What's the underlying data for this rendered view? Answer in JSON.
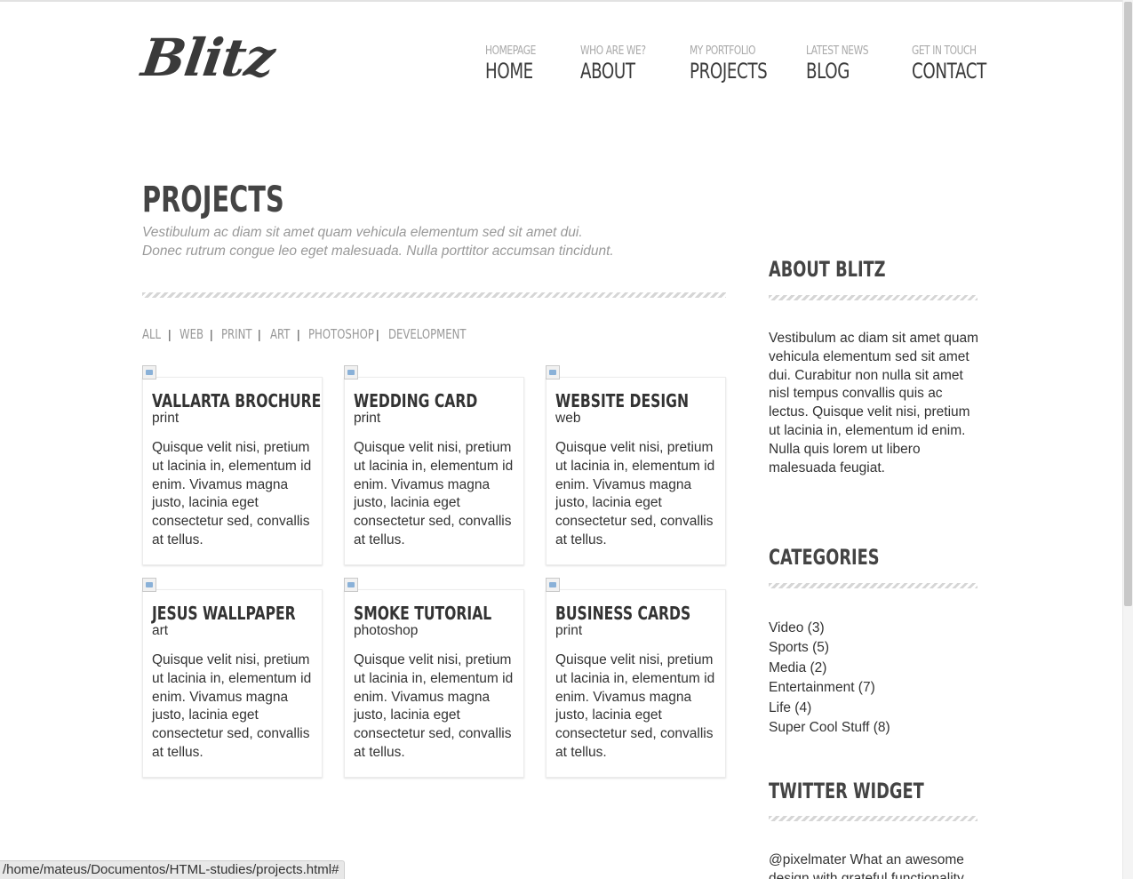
{
  "logo": "Blitz",
  "nav": [
    {
      "sub": "HOMEPAGE",
      "main": "HOME"
    },
    {
      "sub": "WHO ARE WE?",
      "main": "ABOUT"
    },
    {
      "sub": "MY PORTFOLIO",
      "main": "PROJECTS"
    },
    {
      "sub": "LATEST NEWS",
      "main": "BLOG"
    },
    {
      "sub": "GET IN TOUCH",
      "main": "CONTACT"
    }
  ],
  "page": {
    "title": "PROJECTS",
    "intro": "Vestibulum ac diam sit amet quam vehicula elementum sed sit amet dui. Donec rutrum congue leo eget malesuada. Nulla porttitor accumsan tincidunt."
  },
  "filters": [
    "ALL",
    "WEB",
    "PRINT",
    "ART",
    "PHOTOSHOP",
    "DEVELOPMENT"
  ],
  "filter_separator": "|",
  "projects": [
    {
      "title": "VALLARTA BROCHURE",
      "category": "print",
      "text": "Quisque velit nisi, pretium ut lacinia in, elementum id enim. Vivamus magna justo, lacinia eget consectetur sed, convallis at tellus."
    },
    {
      "title": "WEDDING CARD",
      "category": "print",
      "text": "Quisque velit nisi, pretium ut lacinia in, elementum id enim. Vivamus magna justo, lacinia eget consectetur sed, convallis at tellus."
    },
    {
      "title": "WEBSITE DESIGN",
      "category": "web",
      "text": "Quisque velit nisi, pretium ut lacinia in, elementum id enim. Vivamus magna justo, lacinia eget consectetur sed, convallis at tellus."
    },
    {
      "title": "JESUS WALLPAPER",
      "category": "art",
      "text": "Quisque velit nisi, pretium ut lacinia in, elementum id enim. Vivamus magna justo, lacinia eget consectetur sed, convallis at tellus."
    },
    {
      "title": "SMOKE TUTORIAL",
      "category": "photoshop",
      "text": "Quisque velit nisi, pretium ut lacinia in, elementum id enim. Vivamus magna justo, lacinia eget consectetur sed, convallis at tellus."
    },
    {
      "title": "BUSINESS CARDS",
      "category": "print",
      "text": "Quisque velit nisi, pretium ut lacinia in, elementum id enim. Vivamus magna justo, lacinia eget consectetur sed, convallis at tellus."
    }
  ],
  "sidebar": {
    "about_heading": "ABOUT BLITZ",
    "about_text": "Vestibulum ac diam sit amet quam vehicula elementum sed sit amet dui. Curabitur non nulla sit amet nisl tempus convallis quis ac lectus. Quisque velit nisi, pretium ut lacinia in, elementum id enim. Nulla quis lorem ut libero malesuada feugiat.",
    "categories_heading": "CATEGORIES",
    "categories": [
      "Video (3)",
      "Sports (5)",
      "Media (2)",
      "Entertainment (7)",
      "Life (4)",
      "Super Cool Stuff (8)"
    ],
    "twitter_heading": "TWITTER WIDGET",
    "tweet": "@pixelmater What an awesome design with grateful functionality"
  },
  "status_bar": "/home/mateus/Documentos/HTML-studies/projects.html#"
}
